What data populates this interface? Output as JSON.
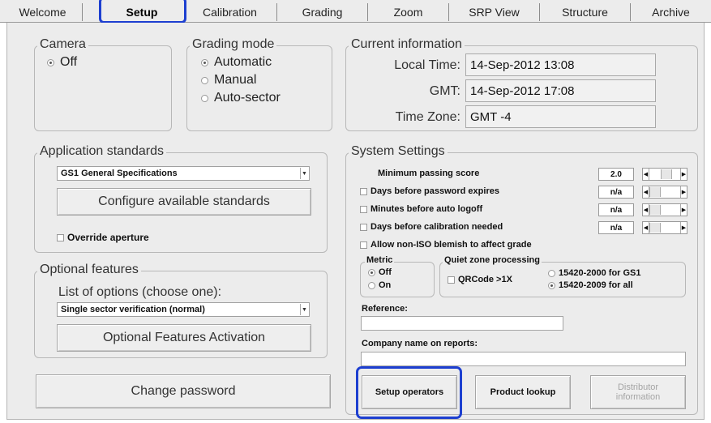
{
  "tabs": [
    {
      "label": "Welcome"
    },
    {
      "label": "Setup"
    },
    {
      "label": "Calibration"
    },
    {
      "label": "Grading"
    },
    {
      "label": "Zoom"
    },
    {
      "label": "SRP View"
    },
    {
      "label": "Structure"
    },
    {
      "label": "Archive"
    }
  ],
  "camera": {
    "title": "Camera",
    "option": "Off"
  },
  "grading_mode": {
    "title": "Grading mode",
    "options": [
      "Automatic",
      "Manual",
      "Auto-sector"
    ],
    "selected": "Automatic"
  },
  "current_info": {
    "title": "Current information",
    "local_time_label": "Local Time:",
    "local_time": "14-Sep-2012 13:08",
    "gmt_label": "GMT:",
    "gmt": "14-Sep-2012 17:08",
    "timezone_label": "Time Zone:",
    "timezone": "GMT -4"
  },
  "app_standards": {
    "title": "Application standards",
    "selected": "GS1 General Specifications",
    "configure_label": "Configure available standards",
    "override_label": "Override aperture"
  },
  "optional_features": {
    "title": "Optional features",
    "list_label": "List of options (choose one):",
    "selected": "Single sector verification (normal)",
    "activation_label": "Optional Features Activation"
  },
  "change_password_label": "Change password",
  "system_settings": {
    "title": "System Settings",
    "min_score_label": "Minimum passing score",
    "min_score": "2.0",
    "password_expires_label": "Days before password expires",
    "password_expires": "n/a",
    "auto_logoff_label": "Minutes before auto logoff",
    "auto_logoff": "n/a",
    "calibration_label": "Days before calibration needed",
    "calibration": "n/a",
    "blemish_label": "Allow non-ISO blemish to affect grade",
    "metric_title": "Metric",
    "metric_off": "Off",
    "metric_on": "On",
    "quiet_zone_title": "Quiet zone processing",
    "qrcode_label": "QRCode >1X",
    "qz_option1": "15420-2000 for GS1",
    "qz_option2": "15420-2009 for all",
    "reference_label": "Reference:",
    "company_label": "Company name on reports:"
  },
  "buttons": {
    "setup_operators": "Setup operators",
    "product_lookup": "Product lookup",
    "distributor_line1": "Distributor",
    "distributor_line2": "information"
  },
  "colors": {
    "highlight": "#1d3fd0",
    "panel": "#ececec"
  }
}
